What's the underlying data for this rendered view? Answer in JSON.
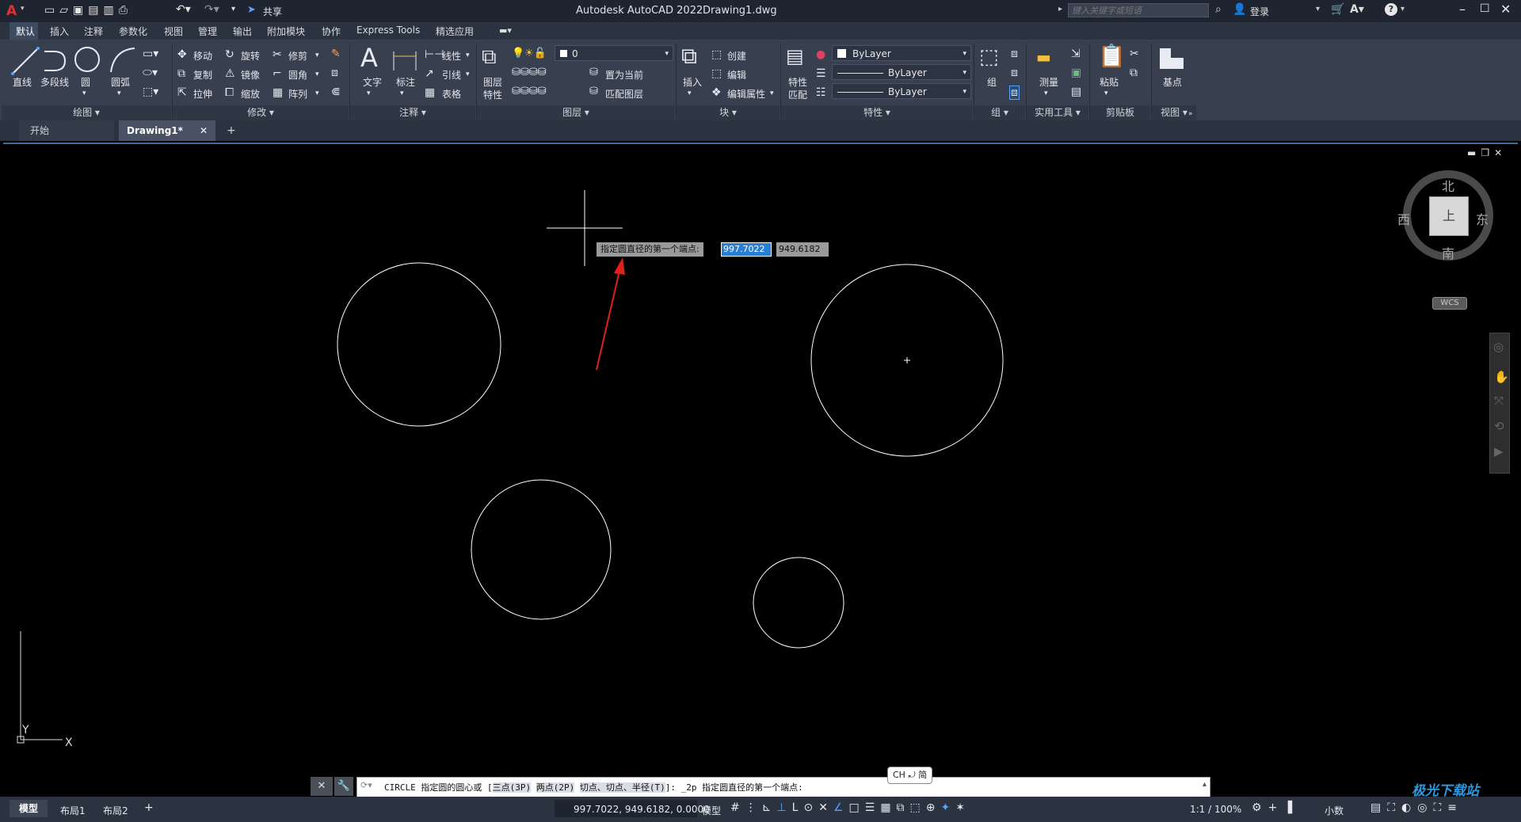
{
  "titlebar": {
    "app_title": "Autodesk AutoCAD 2022",
    "file_name": "Drawing1.dwg",
    "share_label": "共享",
    "search_placeholder": "键入关键字或短语",
    "login_label": "登录"
  },
  "ribbon_tabs": [
    "默认",
    "插入",
    "注释",
    "参数化",
    "视图",
    "管理",
    "输出",
    "附加模块",
    "协作",
    "Express Tools",
    "精选应用"
  ],
  "draw_panel": {
    "title": "绘图",
    "line": "直线",
    "polyline": "多段线",
    "circle": "圆",
    "arc": "圆弧"
  },
  "modify_panel": {
    "title": "修改",
    "move": "移动",
    "rotate": "旋转",
    "trim": "修剪",
    "copy": "复制",
    "mirror": "镜像",
    "fillet": "圆角",
    "stretch": "拉伸",
    "scale": "缩放",
    "array": "阵列"
  },
  "annotation_panel": {
    "title": "注释",
    "text": "文字",
    "dimension": "标注",
    "linear": "线性",
    "leader": "引线",
    "table": "表格"
  },
  "layers_panel": {
    "title": "图层",
    "layer_props_1": "图层",
    "layer_props_2": "特性",
    "current_layer": "0",
    "set_current": "置为当前",
    "match_layer": "匹配图层"
  },
  "block_panel": {
    "title": "块",
    "insert": "插入",
    "create": "创建",
    "edit": "编辑",
    "edit_attrs": "编辑属性"
  },
  "properties_panel": {
    "title": "特性",
    "match_1": "特性",
    "match_2": "匹配",
    "color": "ByLayer",
    "linetype": "ByLayer",
    "lineweight": "ByLayer"
  },
  "groups_panel": {
    "title": "组",
    "group": "组"
  },
  "utilities_panel": {
    "title": "实用工具",
    "measure": "测量"
  },
  "clipboard_panel": {
    "title": "剪贴板",
    "paste": "粘贴"
  },
  "view_panel": {
    "title": "视图",
    "base": "基点"
  },
  "doc_tabs": {
    "start": "开始",
    "drawing": "Drawing1*"
  },
  "viewcube": {
    "north": "北",
    "south": "南",
    "east": "东",
    "west": "西",
    "top": "上",
    "wcs": "WCS"
  },
  "tooltip": {
    "prompt": "指定圆直径的第一个端点:",
    "x_value": "997.7022",
    "y_value": "949.6182"
  },
  "ucs": {
    "y": "Y",
    "x": "X"
  },
  "command": {
    "text_a": "CIRCLE 指定圆的圆心或 [",
    "opt_3p": "三点(3P)",
    "opt_2p": "两点(2P)",
    "opt_ttr": "切点、切点、半径(T)",
    "text_b": "]: _2p 指定圆直径的第一个端点:",
    "ime": "CH ⤾ 简"
  },
  "layout_tabs": [
    "模型",
    "布局1",
    "布局2"
  ],
  "status": {
    "coords": "997.7022, 949.6182, 0.0000",
    "model": "模型",
    "scale": "1:1 / 100%",
    "units": "小数"
  },
  "watermark": "极光下载站",
  "colors": {
    "accent": "#2a7fd4",
    "arrow": "#e0201a",
    "ribbon_bg": "#384050"
  }
}
